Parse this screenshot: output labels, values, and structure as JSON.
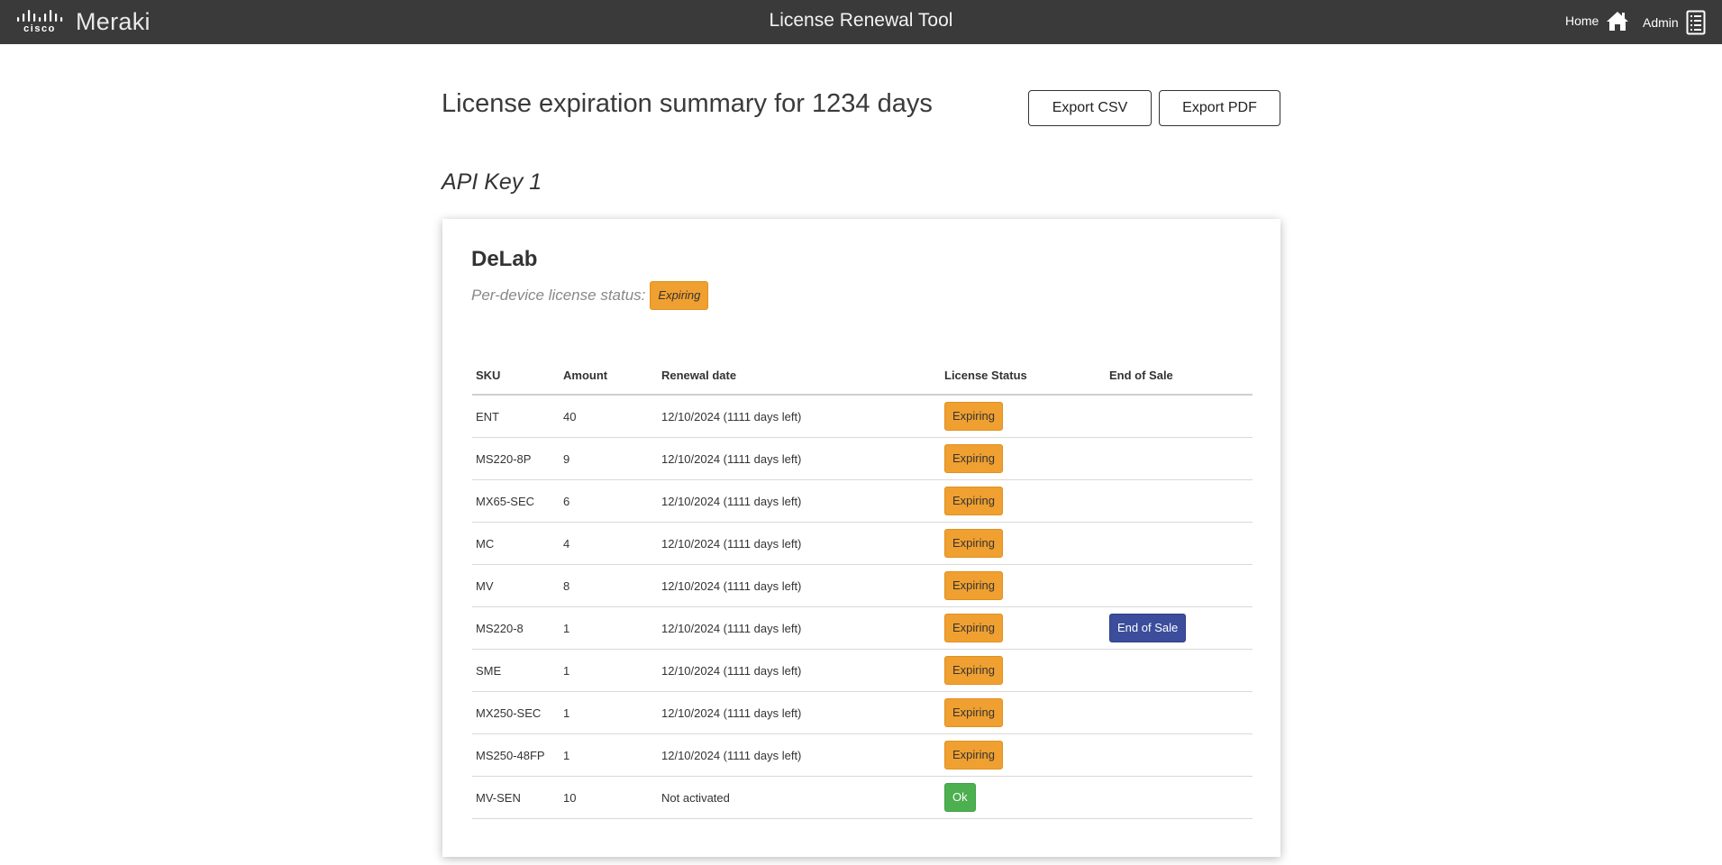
{
  "header": {
    "logo_cisco": "cisco",
    "logo_meraki": "Meraki",
    "title": "License Renewal Tool",
    "home_label": "Home",
    "admin_label": "Admin"
  },
  "summary": {
    "title": "License expiration summary for 1234 days",
    "export_csv_label": "Export CSV",
    "export_pdf_label": "Export PDF"
  },
  "api_key_label": "API Key 1",
  "org": {
    "name": "DeLab",
    "status_label": "Per-device license status:",
    "status_value": "Expiring"
  },
  "table": {
    "headers": [
      "SKU",
      "Amount",
      "Renewal date",
      "License Status",
      "End of Sale"
    ],
    "rows": [
      {
        "sku": "ENT",
        "amount": "40",
        "renewal": "12/10/2024 (1111 days left)",
        "status": "Expiring",
        "eos": ""
      },
      {
        "sku": "MS220-8P",
        "amount": "9",
        "renewal": "12/10/2024 (1111 days left)",
        "status": "Expiring",
        "eos": ""
      },
      {
        "sku": "MX65-SEC",
        "amount": "6",
        "renewal": "12/10/2024 (1111 days left)",
        "status": "Expiring",
        "eos": ""
      },
      {
        "sku": "MC",
        "amount": "4",
        "renewal": "12/10/2024 (1111 days left)",
        "status": "Expiring",
        "eos": ""
      },
      {
        "sku": "MV",
        "amount": "8",
        "renewal": "12/10/2024 (1111 days left)",
        "status": "Expiring",
        "eos": ""
      },
      {
        "sku": "MS220-8",
        "amount": "1",
        "renewal": "12/10/2024 (1111 days left)",
        "status": "Expiring",
        "eos": "End of Sale"
      },
      {
        "sku": "SME",
        "amount": "1",
        "renewal": "12/10/2024 (1111 days left)",
        "status": "Expiring",
        "eos": ""
      },
      {
        "sku": "MX250-SEC",
        "amount": "1",
        "renewal": "12/10/2024 (1111 days left)",
        "status": "Expiring",
        "eos": ""
      },
      {
        "sku": "MS250-48FP",
        "amount": "1",
        "renewal": "12/10/2024 (1111 days left)",
        "status": "Expiring",
        "eos": ""
      },
      {
        "sku": "MV-SEN",
        "amount": "10",
        "renewal": "Not activated",
        "status": "Ok",
        "eos": ""
      }
    ]
  },
  "colors": {
    "header_bg": "#3a3a3a",
    "expiring": "#f0a030",
    "ok": "#4caf50",
    "end_of_sale": "#3b4d9b"
  },
  "icons": {
    "home": "home-icon",
    "admin": "admin-list-icon",
    "logo": "cisco-bridge-logo"
  }
}
